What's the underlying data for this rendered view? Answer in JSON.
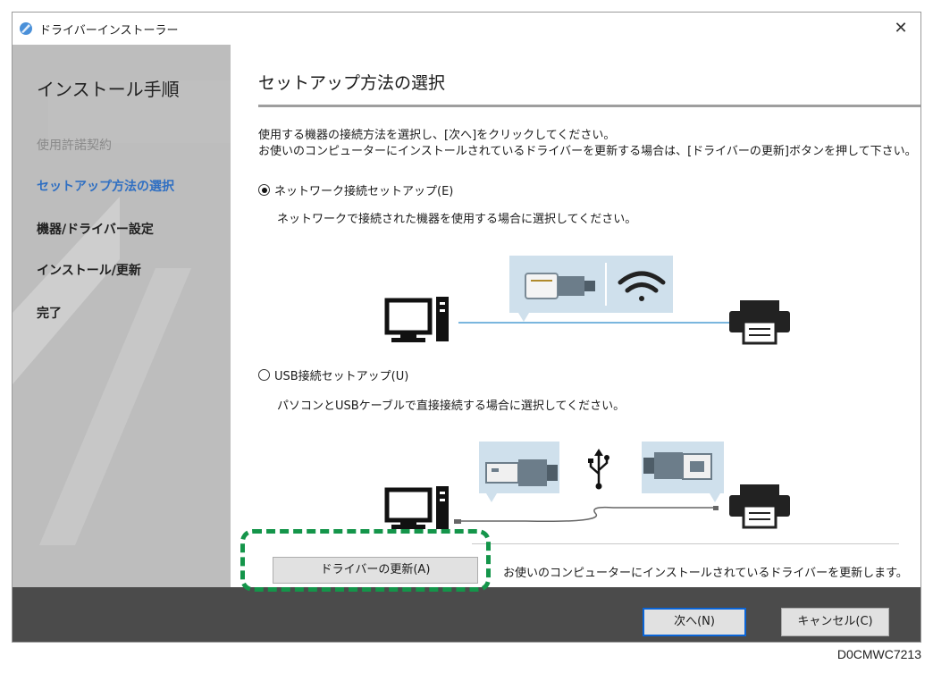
{
  "window": {
    "title": "ドライバーインストーラー",
    "close_glyph": "✕"
  },
  "sidebar": {
    "title": "インストール手順",
    "steps": [
      {
        "label": "使用許諾契約",
        "state": "done"
      },
      {
        "label": "セットアップ方法の選択",
        "state": "current"
      },
      {
        "label": "機器/ドライバー設定",
        "state": "pending"
      },
      {
        "label": "インストール/更新",
        "state": "pending"
      },
      {
        "label": "完了",
        "state": "pending"
      }
    ]
  },
  "main": {
    "title": "セットアップ方法の選択",
    "instructions": [
      "使用する機器の接続方法を選択し、[次へ]をクリックしてください。",
      "お使いのコンピューターにインストールされているドライバーを更新する場合は、[ドライバーの更新]ボタンを押して下さい。"
    ],
    "options": [
      {
        "label": "ネットワーク接続セットアップ(E)",
        "description": "ネットワークで接続された機器を使用する場合に選択してください。",
        "selected": true
      },
      {
        "label": "USB接続セットアップ(U)",
        "description": "パソコンとUSBケーブルで直接接続する場合に選択してください。",
        "selected": false
      }
    ],
    "update_button": "ドライバーの更新(A)",
    "update_description": "お使いのコンピューターにインストールされているドライバーを更新します。"
  },
  "footer": {
    "next": "次へ(N)",
    "cancel": "キャンセル(C)"
  },
  "figure_code": "D0CMWC7213",
  "colors": {
    "accent": "#2f6fc2",
    "highlight": "#14954a",
    "footer_bg": "#4b4b4b",
    "sidebar_bg": "#bdbdbd",
    "illus_panel": "#cfe0ec",
    "cable_line": "#7ab6de"
  },
  "icons": [
    "app-icon",
    "close-icon",
    "computer-icon",
    "printer-icon",
    "ethernet-plug-icon",
    "wifi-icon",
    "usb-a-plug-icon",
    "usb-symbol-icon",
    "usb-b-plug-icon"
  ]
}
